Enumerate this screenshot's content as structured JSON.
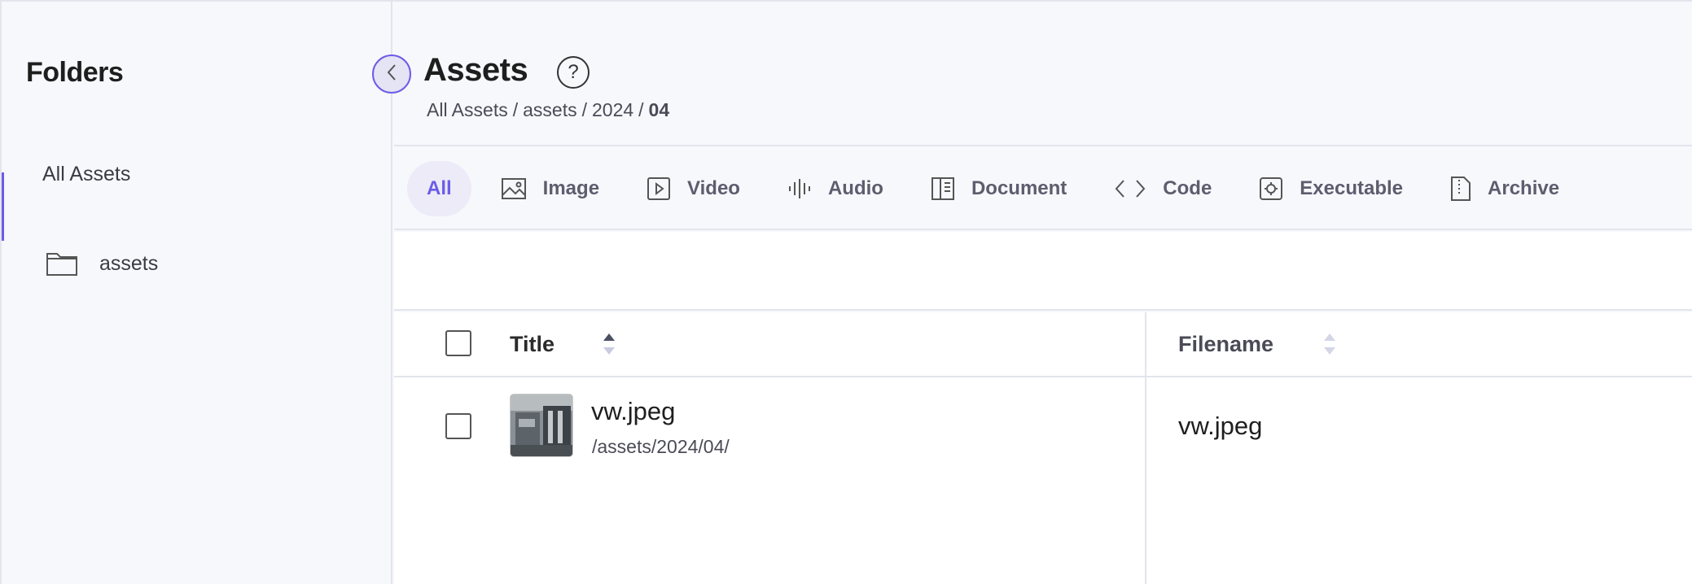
{
  "sidebar": {
    "title": "Folders",
    "items": [
      {
        "label": "All Assets",
        "active": true
      },
      {
        "label": "assets",
        "icon": "folder-icon"
      }
    ],
    "accent_color": "#6c5ce7"
  },
  "header": {
    "title": "Assets",
    "help_symbol": "?",
    "breadcrumb": [
      "All Assets",
      "assets",
      "2024",
      "04"
    ],
    "breadcrumb_sep": "/"
  },
  "tabs": [
    {
      "label": "All",
      "active": true
    },
    {
      "label": "Image",
      "icon": "image-icon"
    },
    {
      "label": "Video",
      "icon": "video-icon"
    },
    {
      "label": "Audio",
      "icon": "audio-icon"
    },
    {
      "label": "Document",
      "icon": "document-icon"
    },
    {
      "label": "Code",
      "icon": "code-icon"
    },
    {
      "label": "Executable",
      "icon": "executable-icon"
    },
    {
      "label": "Archive",
      "icon": "archive-icon"
    }
  ],
  "table": {
    "columns": [
      {
        "label": "Title",
        "sort": "ascending"
      },
      {
        "label": "Filename",
        "sort": "none"
      }
    ],
    "rows": [
      {
        "title": "vw.jpeg",
        "path": "/assets/2024/04/",
        "filename": "vw.jpeg",
        "thumbnail": "image-thumbnail"
      }
    ]
  }
}
